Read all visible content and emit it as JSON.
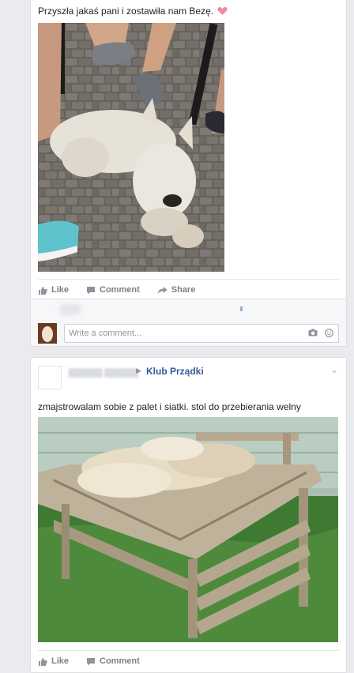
{
  "post1": {
    "text": "Przyszła jakaś pani i zostawiła nam Bezę.",
    "heart_icon": "heart-emoji",
    "actions": {
      "like": "Like",
      "comment": "Comment",
      "share": "Share"
    }
  },
  "comment_box": {
    "placeholder": "Write a comment...",
    "camera_icon": "camera-icon",
    "emoji_icon": "emoji-icon"
  },
  "post2": {
    "group": "Klub Prządki",
    "text": "zmajstrowalam sobie z palet i siatki. stol do przebierania welny",
    "actions": {
      "like": "Like",
      "comment": "Comment"
    }
  },
  "colors": {
    "link": "#365899",
    "background": "#e9ebee",
    "action_text": "#7f7f7f"
  }
}
